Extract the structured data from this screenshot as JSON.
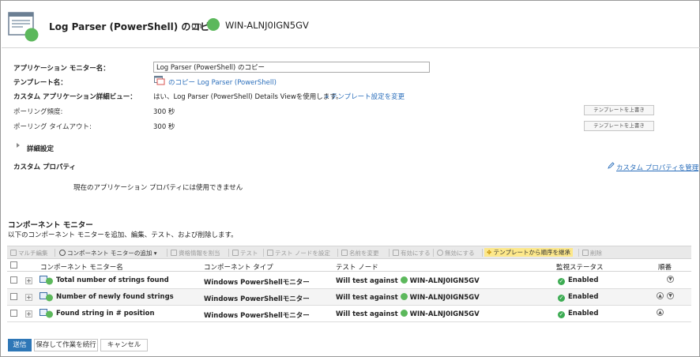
{
  "header": {
    "title": "Log Parser (PowerShell) のコピー",
    "on": "on",
    "node": "WIN-ALNJ0IGN5GV",
    "status_color": "#5cb85c"
  },
  "form": {
    "app_monitor_name_label": "アプリケーション モニター名：",
    "app_monitor_name_value": "Log Parser (PowerShell) のコピー",
    "template_name_label": "テンプレート名：",
    "template_name_link": "のコピー Log Parser (PowerShell)",
    "custom_view_label": "カスタム アプリケーション詳細ビュー：",
    "custom_view_text": "はい、Log Parser (PowerShell) Details Viewを使用します。",
    "custom_view_link": "» テンプレート設定を変更",
    "polling_freq_label": "ポーリング頻度:",
    "polling_freq_value": "300 秒",
    "polling_timeout_label": "ポーリング タイムアウト:",
    "polling_timeout_value": "300 秒",
    "override_template_button": "テンプレートを上書き",
    "advanced_label": "詳細設定",
    "custom_props_label": "カスタム プロパティ",
    "manage_custom_props_link": "カスタム プロパティを管理",
    "no_props_text": "現在のアプリケーション プロパティには使用できません"
  },
  "components": {
    "title": "コンポーネント モニター",
    "description": "以下のコンポーネント モニターを追加、編集、テスト、および削除します。",
    "toolbar": {
      "multi_edit": "マルチ編集",
      "add_monitor": "コンポーネント モニターの追加",
      "assign_credentials": "資格情報を割当",
      "test": "テスト",
      "set_test_node": "テスト ノードを設定",
      "rename": "名前を変更",
      "enable": "有効にする",
      "disable": "無効にする",
      "inherit_order": "テンプレートから順序を継承",
      "delete": "削除"
    },
    "columns": [
      "コンポーネント モニター名",
      "コンポーネント タイプ",
      "テスト ノード",
      "監視ステータス",
      "順番"
    ],
    "rows": [
      {
        "name": "Total number of strings found",
        "type": "Windows PowerShellモニター",
        "test_prefix": "Will test against",
        "test_node": "WIN-ALNJ0IGN5GV",
        "status": "Enabled"
      },
      {
        "name": "Number of newly found strings",
        "type": "Windows PowerShellモニター",
        "test_prefix": "Will test against",
        "test_node": "WIN-ALNJ0IGN5GV",
        "status": "Enabled"
      },
      {
        "name": "Found string in # position",
        "type": "Windows PowerShellモニター",
        "test_prefix": "Will test against",
        "test_node": "WIN-ALNJ0IGN5GV",
        "status": "Enabled"
      }
    ]
  },
  "footer": {
    "submit": "送信",
    "save_continue": "保存して作業を続行",
    "cancel": "キャンセル"
  },
  "colors": {
    "accent": "#2e77b7",
    "link": "#2a6ebb",
    "status_up": "#5cb85c",
    "highlight": "#fde88a"
  }
}
